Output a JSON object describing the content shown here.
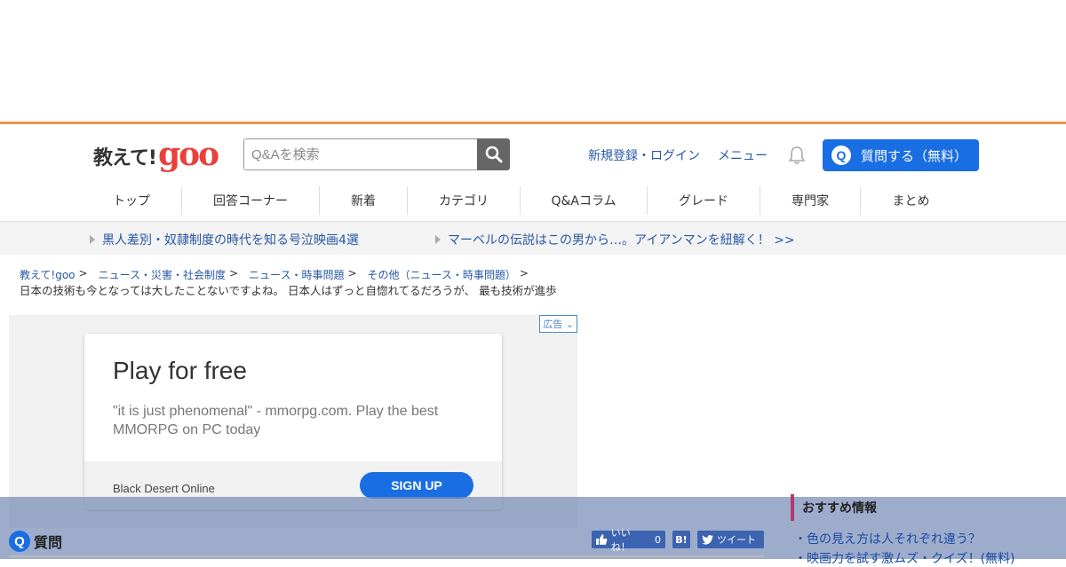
{
  "logo": {
    "text": "教えて!",
    "brand": "goo"
  },
  "search": {
    "placeholder": "Q&Aを検索"
  },
  "header_links": {
    "register": "新規登録・ログイン",
    "menu": "メニュー"
  },
  "ask_button": {
    "icon": "Q",
    "label": "質問する（無料）"
  },
  "nav": [
    {
      "label": "トップ"
    },
    {
      "label": "回答コーナー"
    },
    {
      "label": "新着"
    },
    {
      "label": "カテゴリ"
    },
    {
      "label": "Q&Aコラム"
    },
    {
      "label": "グレード"
    },
    {
      "label": "専門家"
    },
    {
      "label": "まとめ"
    }
  ],
  "promos": [
    {
      "text": "黒人差別・奴隷制度の時代を知る号泣映画4選"
    },
    {
      "text": "マーベルの伝説はこの男から…。アイアンマンを紐解く！ >>"
    }
  ],
  "breadcrumb": [
    {
      "label": "教えて!goo"
    },
    {
      "label": "ニュース・災害・社会制度"
    },
    {
      "label": "ニュース・時事問題"
    },
    {
      "label": "その他（ニュース・時事問題）"
    }
  ],
  "breadcrumb_sep": ">",
  "page_title": "日本の技術も今となっては大したことないですよね。 日本人はずっと自惚れてるだろうが、 最も技術が進歩",
  "ad": {
    "label": "広告",
    "title": "Play for free",
    "description": "\"it is just phenomenal\" - mmorpg.com. Play the best MMORPG on PC today",
    "brand": "Black Desert Online",
    "cta": "SIGN UP"
  },
  "question": {
    "icon": "Q",
    "label": "質問"
  },
  "share": {
    "like": "いいね！",
    "like_count": "0",
    "hatena": "B!",
    "tweet": "ツイート"
  },
  "recommend": {
    "heading": "おすすめ情報",
    "items": [
      {
        "text": "・色の見え方は人それぞれ違う？"
      },
      {
        "text": "・映画力を試す激ムズ・クイズ！(無料)"
      }
    ]
  }
}
